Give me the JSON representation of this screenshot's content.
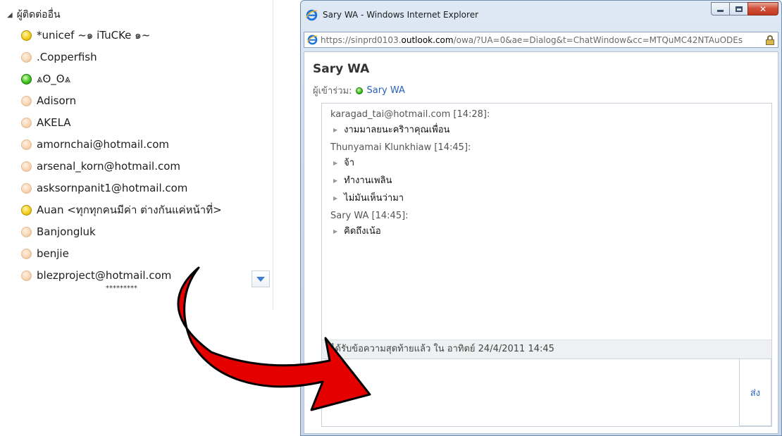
{
  "contacts_panel": {
    "group_label": "ผู้ติดต่ออื่น",
    "contacts": [
      {
        "name": "*unicef ~๑ iTuCKe ๑~",
        "status": "yellow"
      },
      {
        "name": ".Copperfish",
        "status": "peach"
      },
      {
        "name": "⩓ʘ_ʘ⩓",
        "status": "green"
      },
      {
        "name": "Adisorn",
        "status": "peach"
      },
      {
        "name": "AKELA",
        "status": "peach"
      },
      {
        "name": "amornchai@hotmail.com",
        "status": "peach"
      },
      {
        "name": "arsenal_korn@hotmail.com",
        "status": "peach"
      },
      {
        "name": "asksornpanit1@hotmail.com",
        "status": "peach"
      },
      {
        "name": "Auan <ทุกทุกคนมีค่า ต่างกันแค่หน้าที่>",
        "status": "yellow"
      },
      {
        "name": "Banjongluk",
        "status": "peach"
      },
      {
        "name": "benjie",
        "status": "peach"
      },
      {
        "name": "blezproject@hotmail.com",
        "status": "peach"
      }
    ],
    "more_indicator": "*********",
    "colors": {
      "online": "#3fc21e",
      "away": "#f4cf1d",
      "offline": "#f6d3b0",
      "arrow": "#e50000"
    }
  },
  "ie_window": {
    "title": "Sary WA - Windows Internet Explorer",
    "url_prefix": "https://sinprd0103.",
    "url_domain": "outlook.com",
    "url_rest": "/owa/?UA=0&ae=Dialog&t=ChatWindow&cc=MTQuMC42NTAuODEs",
    "chat": {
      "name": "Sary WA",
      "participants_label": "ผู้เข้าร่วม:",
      "participant_name": "Sary WA",
      "messages": [
        {
          "header": "karagad_tai@hotmail.com [14:28]:",
          "lines": [
            "งามมาลยนะคริาาคุณเพื่อน"
          ]
        },
        {
          "header": "Thunyamai Klunkhiaw [14:45]:",
          "lines": [
            "จ้า",
            "ทำงานเพลิน",
            "ไม่มันเห็นว่ามา"
          ]
        },
        {
          "header": "Sary WA [14:45]:",
          "lines": [
            "คิดถึงเน้อ"
          ]
        }
      ],
      "status_text": "ได้รับข้อความสุดท้ายแล้ว ใน อาทิตย์ 24/4/2011 14:45",
      "send_label": "ส่ง",
      "accent_color": "#2a62b8"
    }
  }
}
